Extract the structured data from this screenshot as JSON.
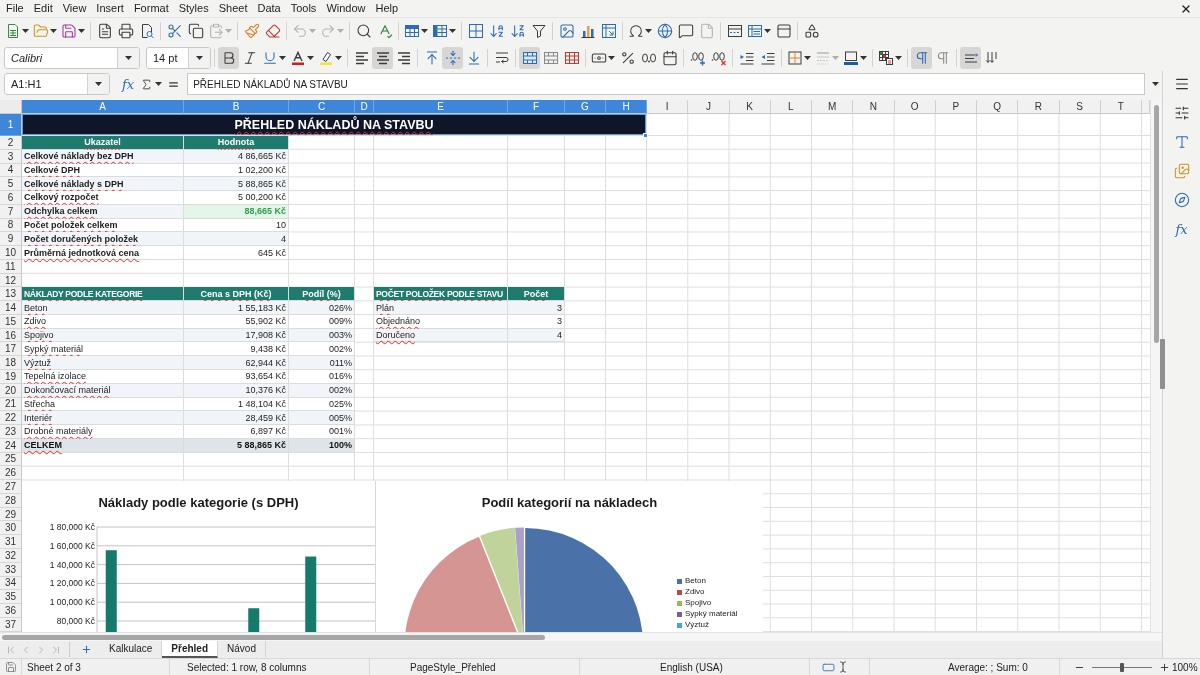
{
  "menu_bar": [
    "File",
    "Edit",
    "View",
    "Insert",
    "Format",
    "Styles",
    "Sheet",
    "Data",
    "Tools",
    "Window",
    "Help"
  ],
  "standard_toolbar": {
    "groups": [
      {
        "items": [
          {
            "kind": "new",
            "dropdown": true,
            "disabled": false
          },
          {
            "kind": "open",
            "dropdown": true,
            "disabled": false
          },
          {
            "kind": "save",
            "dropdown": true,
            "disabled": false
          }
        ]
      },
      {
        "items": [
          {
            "kind": "pdf",
            "dropdown": false,
            "disabled": false
          },
          {
            "kind": "print",
            "dropdown": false,
            "disabled": false
          },
          {
            "kind": "preview",
            "dropdown": false,
            "disabled": false
          }
        ]
      },
      {
        "items": [
          {
            "kind": "cut",
            "dropdown": false,
            "disabled": false
          },
          {
            "kind": "copy",
            "dropdown": false,
            "disabled": false
          },
          {
            "kind": "paste",
            "dropdown": true,
            "disabled": true
          }
        ]
      },
      {
        "items": [
          {
            "kind": "clone",
            "dropdown": false,
            "disabled": false
          },
          {
            "kind": "clear",
            "dropdown": false,
            "disabled": false
          }
        ]
      },
      {
        "items": [
          {
            "kind": "undo",
            "dropdown": true,
            "disabled": true
          },
          {
            "kind": "redo",
            "dropdown": true,
            "disabled": true
          }
        ]
      },
      {
        "items": [
          {
            "kind": "find",
            "dropdown": false,
            "disabled": false
          },
          {
            "kind": "spelling",
            "dropdown": false,
            "disabled": false
          }
        ]
      },
      {
        "items": [
          {
            "kind": "row",
            "dropdown": true,
            "disabled": false
          },
          {
            "kind": "column",
            "dropdown": true,
            "disabled": false
          }
        ]
      },
      {
        "items": [
          {
            "kind": "sort",
            "dropdown": false,
            "disabled": false
          },
          {
            "kind": "ascending",
            "dropdown": false,
            "disabled": false
          },
          {
            "kind": "descending",
            "dropdown": false,
            "disabled": false
          },
          {
            "kind": "autofilter",
            "dropdown": false,
            "disabled": false
          }
        ]
      },
      {
        "items": [
          {
            "kind": "image",
            "dropdown": false,
            "disabled": false
          },
          {
            "kind": "chart",
            "dropdown": false,
            "disabled": false
          },
          {
            "kind": "pivot",
            "dropdown": false,
            "disabled": false
          }
        ]
      },
      {
        "items": [
          {
            "kind": "special",
            "dropdown": true,
            "disabled": false
          },
          {
            "kind": "hyperlink",
            "dropdown": false,
            "disabled": false
          },
          {
            "kind": "comment",
            "dropdown": false,
            "disabled": false
          },
          {
            "kind": "headerfooter",
            "dropdown": false,
            "disabled": true
          }
        ]
      },
      {
        "items": [
          {
            "kind": "printarea",
            "dropdown": false,
            "disabled": false
          },
          {
            "kind": "freeze",
            "dropdown": true,
            "disabled": false
          },
          {
            "kind": "split",
            "dropdown": false,
            "disabled": false
          }
        ]
      },
      {
        "items": [
          {
            "kind": "draw",
            "dropdown": false,
            "disabled": false
          }
        ]
      }
    ]
  },
  "formatting_toolbar": {
    "font_name": "Calibri",
    "font_size": "14 pt",
    "groups": [
      {
        "items": [
          {
            "kind": "bold",
            "dropdown": false,
            "disabled": false,
            "on": true
          },
          {
            "kind": "italic",
            "dropdown": false,
            "disabled": false,
            "on": false
          },
          {
            "kind": "underline",
            "dropdown": true,
            "disabled": false,
            "on": false
          },
          {
            "kind": "fontcolor",
            "dropdown": true,
            "disabled": false,
            "on": false
          },
          {
            "kind": "highlight",
            "dropdown": true,
            "disabled": false,
            "on": false
          }
        ]
      },
      {
        "items": [
          {
            "kind": "left",
            "dropdown": false,
            "disabled": false,
            "on": false
          },
          {
            "kind": "center",
            "dropdown": false,
            "disabled": false,
            "on": true
          },
          {
            "kind": "right",
            "dropdown": false,
            "disabled": false,
            "on": false
          }
        ]
      },
      {
        "items": [
          {
            "kind": "top",
            "dropdown": false,
            "disabled": false,
            "on": false
          },
          {
            "kind": "middle",
            "dropdown": false,
            "disabled": false,
            "on": true
          },
          {
            "kind": "bottom",
            "dropdown": false,
            "disabled": false,
            "on": false
          }
        ]
      },
      {
        "items": [
          {
            "kind": "wrap",
            "dropdown": false,
            "disabled": false,
            "on": false
          }
        ]
      },
      {
        "items": [
          {
            "kind": "mergecenter",
            "dropdown": false,
            "disabled": false,
            "on": true
          },
          {
            "kind": "merge",
            "dropdown": false,
            "disabled": false,
            "on": false
          },
          {
            "kind": "unmerge",
            "dropdown": false,
            "disabled": false,
            "on": false
          }
        ]
      },
      {
        "items": [
          {
            "kind": "currency",
            "dropdown": true,
            "disabled": false,
            "on": false
          },
          {
            "kind": "percent",
            "dropdown": false,
            "disabled": false,
            "on": false
          },
          {
            "kind": "number",
            "dropdown": false,
            "disabled": false,
            "on": false
          },
          {
            "kind": "date",
            "dropdown": false,
            "disabled": false,
            "on": false
          }
        ]
      },
      {
        "items": [
          {
            "kind": "adddecimal",
            "dropdown": false,
            "disabled": false,
            "on": false
          },
          {
            "kind": "deletedecimal",
            "dropdown": false,
            "disabled": false,
            "on": false
          }
        ]
      },
      {
        "items": [
          {
            "kind": "indent",
            "dropdown": false,
            "disabled": false,
            "on": false
          },
          {
            "kind": "outdent",
            "dropdown": false,
            "disabled": false,
            "on": false
          }
        ]
      },
      {
        "items": [
          {
            "kind": "borders",
            "dropdown": true,
            "disabled": false,
            "on": false
          },
          {
            "kind": "borderstyle",
            "dropdown": true,
            "disabled": true,
            "on": false
          },
          {
            "kind": "bordercolor",
            "dropdown": true,
            "disabled": false,
            "on": false
          }
        ]
      },
      {
        "items": [
          {
            "kind": "conditional",
            "dropdown": true,
            "disabled": false,
            "on": false
          }
        ]
      },
      {
        "items": [
          {
            "kind": "ltr",
            "dropdown": false,
            "disabled": false,
            "on": true
          },
          {
            "kind": "rtl",
            "dropdown": false,
            "disabled": false,
            "on": false
          }
        ]
      },
      {
        "items": [
          {
            "kind": "horizontal",
            "dropdown": false,
            "disabled": false,
            "on": true
          },
          {
            "kind": "vertical",
            "dropdown": false,
            "disabled": false,
            "on": false
          }
        ]
      }
    ]
  },
  "formula_bar": {
    "name_box": "A1:H1",
    "function_wizard": "fx",
    "content": "PŘEHLED NÁKLADŮ NA STAVBU"
  },
  "sheet": {
    "columns": [
      {
        "label": "A",
        "selected": true
      },
      {
        "label": "B",
        "selected": true
      },
      {
        "label": "C",
        "selected": true
      },
      {
        "label": "D",
        "selected": true
      },
      {
        "label": "E",
        "selected": true
      },
      {
        "label": "F",
        "selected": true
      },
      {
        "label": "G",
        "selected": true
      },
      {
        "label": "H",
        "selected": true
      },
      {
        "label": "I",
        "selected": false
      },
      {
        "label": "J",
        "selected": false
      },
      {
        "label": "K",
        "selected": false
      },
      {
        "label": "L",
        "selected": false
      },
      {
        "label": "M",
        "selected": false
      },
      {
        "label": "N",
        "selected": false
      },
      {
        "label": "O",
        "selected": false
      },
      {
        "label": "P",
        "selected": false
      },
      {
        "label": "Q",
        "selected": false
      },
      {
        "label": "R",
        "selected": false
      },
      {
        "label": "S",
        "selected": false
      },
      {
        "label": "T",
        "selected": false
      }
    ],
    "rows": [
      {
        "label": "1",
        "selected": true,
        "cells": {
          "A": {
            "text": "PŘEHLED NÁKLADŮ NA STAVBU",
            "kind": "title",
            "misspelled": true
          }
        }
      },
      {
        "label": "2",
        "selected": false,
        "cells": {
          "A": {
            "text": "Ukazatel",
            "kind": "header",
            "misspelled": true
          },
          "B": {
            "text": "Hodnota",
            "kind": "header",
            "misspelled": true
          }
        }
      },
      {
        "label": "3",
        "selected": false,
        "shaded": true,
        "cells": {
          "A": {
            "text": "Celkové náklady bez DPH",
            "kind": "label",
            "misspelled": true
          },
          "B": {
            "text": "4 86,665 Kč",
            "kind": "number"
          }
        }
      },
      {
        "label": "4",
        "selected": false,
        "shaded": false,
        "cells": {
          "A": {
            "text": "Celkové DPH",
            "kind": "label",
            "misspelled": true
          },
          "B": {
            "text": "1 02,200 Kč",
            "kind": "number"
          }
        }
      },
      {
        "label": "5",
        "selected": false,
        "shaded": true,
        "cells": {
          "A": {
            "text": "Celkové náklady s DPH",
            "kind": "label",
            "misspelled": true
          },
          "B": {
            "text": "5 88,865 Kč",
            "kind": "number"
          }
        }
      },
      {
        "label": "6",
        "selected": false,
        "shaded": false,
        "cells": {
          "A": {
            "text": "Celkový rozpočet",
            "kind": "label",
            "misspelled": true
          },
          "B": {
            "text": "5 00,200 Kč",
            "kind": "number"
          }
        }
      },
      {
        "label": "7",
        "selected": false,
        "shaded": true,
        "cells": {
          "A": {
            "text": "Odchylka celkem",
            "kind": "label",
            "misspelled": true
          },
          "B": {
            "text": "88,665 Kč",
            "kind": "positive"
          }
        }
      },
      {
        "label": "8",
        "selected": false,
        "shaded": false,
        "cells": {
          "A": {
            "text": "Počet položek celkem",
            "kind": "label",
            "misspelled": true
          },
          "B": {
            "text": "10",
            "kind": "number"
          }
        }
      },
      {
        "label": "9",
        "selected": false,
        "shaded": true,
        "cells": {
          "A": {
            "text": "Počet doručených položek",
            "kind": "label",
            "misspelled": true
          },
          "B": {
            "text": "4",
            "kind": "number"
          }
        }
      },
      {
        "label": "10",
        "selected": false,
        "shaded": false,
        "cells": {
          "A": {
            "text": "Průměrná jednotková cena",
            "kind": "label",
            "misspelled": true
          },
          "B": {
            "text": "645 Kč",
            "kind": "number"
          }
        }
      },
      {
        "label": "11",
        "selected": false
      },
      {
        "label": "12",
        "selected": false
      },
      {
        "label": "13",
        "selected": false,
        "cells": {
          "A": {
            "text": "NÁKLADY PODLE KATEGORIE",
            "kind": "section",
            "misspelled": true
          },
          "B": {
            "text": "Cena s DPH (Kč)",
            "kind": "header",
            "misspelled": true
          },
          "C": {
            "text": "Podíl (%)",
            "kind": "header",
            "misspelled": true
          },
          "E": {
            "text": "POČET POLOŽEK PODLE STAVU",
            "kind": "section",
            "misspelled": true
          },
          "F": {
            "text": "Počet",
            "kind": "header",
            "misspelled": true
          }
        }
      },
      {
        "label": "14",
        "selected": false,
        "shaded": true,
        "cells": {
          "A": {
            "text": "Beton",
            "kind": "text",
            "misspelled": true
          },
          "B": {
            "text": "1 55,183 Kč",
            "kind": "number"
          },
          "C": {
            "text": "026%",
            "kind": "number"
          },
          "E": {
            "text": "Plán",
            "kind": "text",
            "misspelled": true
          },
          "F": {
            "text": "3",
            "kind": "number"
          }
        }
      },
      {
        "label": "15",
        "selected": false,
        "shaded": false,
        "cells": {
          "A": {
            "text": "Zdivo",
            "kind": "text",
            "misspelled": true
          },
          "B": {
            "text": "55,902 Kč",
            "kind": "number"
          },
          "C": {
            "text": "009%",
            "kind": "number"
          },
          "E": {
            "text": "Objednáno",
            "kind": "text",
            "misspelled": true
          },
          "F": {
            "text": "3",
            "kind": "number"
          }
        }
      },
      {
        "label": "16",
        "selected": false,
        "shaded": true,
        "cells": {
          "A": {
            "text": "Spojivo",
            "kind": "text",
            "misspelled": true
          },
          "B": {
            "text": "17,908 Kč",
            "kind": "number"
          },
          "C": {
            "text": "003%",
            "kind": "number"
          },
          "E": {
            "text": "Doručeno",
            "kind": "text",
            "misspelled": true
          },
          "F": {
            "text": "4",
            "kind": "number"
          }
        }
      },
      {
        "label": "17",
        "selected": false,
        "shaded": false,
        "cells": {
          "A": {
            "text": "Sypký materiál",
            "kind": "text",
            "misspelled": true
          },
          "B": {
            "text": "9,438 Kč",
            "kind": "number"
          },
          "C": {
            "text": "002%",
            "kind": "number"
          }
        }
      },
      {
        "label": "18",
        "selected": false,
        "shaded": true,
        "cells": {
          "A": {
            "text": "Výztuž",
            "kind": "text",
            "misspelled": true
          },
          "B": {
            "text": "62,944 Kč",
            "kind": "number"
          },
          "C": {
            "text": "011%",
            "kind": "number"
          }
        }
      },
      {
        "label": "19",
        "selected": false,
        "shaded": false,
        "cells": {
          "A": {
            "text": "Tepelná izolace",
            "kind": "text",
            "misspelled": true
          },
          "B": {
            "text": "93,654 Kč",
            "kind": "number"
          },
          "C": {
            "text": "016%",
            "kind": "number"
          }
        }
      },
      {
        "label": "20",
        "selected": false,
        "shaded": true,
        "cells": {
          "A": {
            "text": "Dokončovací materiál",
            "kind": "text",
            "misspelled": true
          },
          "B": {
            "text": "10,376 Kč",
            "kind": "number"
          },
          "C": {
            "text": "002%",
            "kind": "number"
          }
        }
      },
      {
        "label": "21",
        "selected": false,
        "shaded": false,
        "cells": {
          "A": {
            "text": "Střecha",
            "kind": "text",
            "misspelled": true
          },
          "B": {
            "text": "1 48,104 Kč",
            "kind": "number"
          },
          "C": {
            "text": "025%",
            "kind": "number"
          }
        }
      },
      {
        "label": "22",
        "selected": false,
        "shaded": true,
        "cells": {
          "A": {
            "text": "Interiér",
            "kind": "text",
            "misspelled": true
          },
          "B": {
            "text": "28,459 Kč",
            "kind": "number"
          },
          "C": {
            "text": "005%",
            "kind": "number"
          }
        }
      },
      {
        "label": "23",
        "selected": false,
        "shaded": false,
        "cells": {
          "A": {
            "text": "Drobné materiály",
            "kind": "text",
            "misspelled": true
          },
          "B": {
            "text": "6,897 Kč",
            "kind": "number"
          },
          "C": {
            "text": "001%",
            "kind": "number"
          }
        }
      },
      {
        "label": "24",
        "selected": false,
        "cells": {
          "A": {
            "text": "CELKEM",
            "kind": "total",
            "misspelled": true
          },
          "B": {
            "text": "5 88,865 Kč",
            "kind": "totalnum"
          },
          "C": {
            "text": "100%",
            "kind": "totalnum"
          }
        }
      },
      {
        "label": "25",
        "selected": false
      },
      {
        "label": "26",
        "selected": false
      },
      {
        "label": "27",
        "selected": false
      },
      {
        "label": "28",
        "selected": false
      },
      {
        "label": "29",
        "selected": false
      },
      {
        "label": "30",
        "selected": false
      },
      {
        "label": "31",
        "selected": false
      },
      {
        "label": "32",
        "selected": false
      },
      {
        "label": "33",
        "selected": false
      },
      {
        "label": "34",
        "selected": false
      },
      {
        "label": "35",
        "selected": false
      },
      {
        "label": "36",
        "selected": false
      },
      {
        "label": "37",
        "selected": false
      }
    ],
    "bar_chart": {
      "title": "Náklady podle kategorie (s DPH)",
      "y_axis_labels": [
        "1 80,000 Kč",
        "1 60,000 Kč",
        "1 40,000 Kč",
        "1 20,000 Kč",
        "1 00,000 Kč",
        "80,000 Kč"
      ]
    },
    "pie_chart": {
      "title": "Podíl kategorií na nákladech",
      "legend": [
        {
          "label": "Beton",
          "color": "#4a72a8"
        },
        {
          "label": "Zdivo",
          "color": "#b94b4a"
        },
        {
          "label": "Spojivo",
          "color": "#98b954"
        },
        {
          "label": "Sypký materiál",
          "color": "#7d60a0"
        },
        {
          "label": "Výztuž",
          "color": "#46aac5"
        }
      ]
    }
  },
  "sheet_tabs": {
    "navigation": [
      {
        "kind": "first",
        "disabled": true
      },
      {
        "kind": "previous",
        "disabled": true
      },
      {
        "kind": "next",
        "disabled": true
      },
      {
        "kind": "last",
        "disabled": true
      }
    ],
    "tabs": [
      {
        "label": "Kalkulace",
        "selected": false
      },
      {
        "label": "Přehled",
        "selected": true
      },
      {
        "label": "Návod",
        "selected": false
      }
    ]
  },
  "sidebar": {
    "functions_label": "fx"
  },
  "status_bar": {
    "sheet": "Sheet 2 of 3",
    "selection": "Selected: 1 row, 8 columns",
    "page_style": "PageStyle_Přehled",
    "language": "English (USA)",
    "summary": "Average: ; Sum: 0",
    "zoom": {
      "level": 0.5,
      "reading": "100%"
    }
  }
}
